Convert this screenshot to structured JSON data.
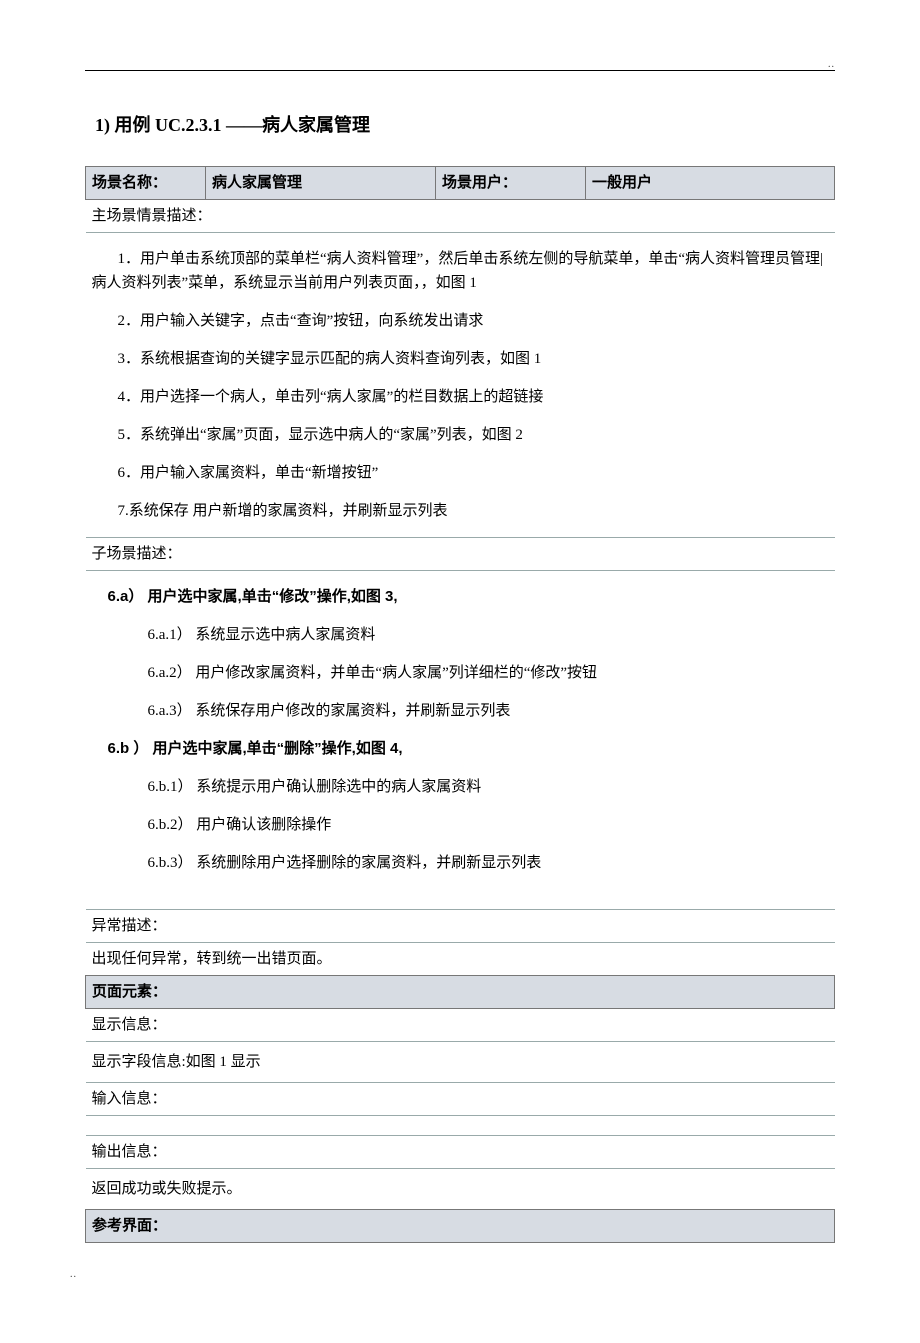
{
  "heading": "1)   用例 UC.2.3.1  ——病人家属管理",
  "header": {
    "scene_name_label": "场景名称：",
    "scene_name_value": "病人家属管理",
    "scene_user_label": "场景用户：",
    "scene_user_value": "一般用户"
  },
  "main_scene_label": "主场景情景描述：",
  "main_steps": [
    "1．用户单击系统顶部的菜单栏“病人资料管理”，然后单击系统左侧的导航菜单，单击“病人资料管理员管理|病人资料列表”菜单，系统显示当前用户列表页面，，如图 1",
    "2．用户输入关键字，点击“查询”按钮，向系统发出请求",
    "3．系统根据查询的关键字显示匹配的病人资料查询列表，如图 1",
    "4．用户选择一个病人，单击列“病人家属”的栏目数据上的超链接",
    "5．系统弹出“家属”页面，显示选中病人的“家属”列表，如图 2",
    "6．用户输入家属资料，单击“新增按钮”",
    "7.系统保存 用户新增的家属资料，并刷新显示列表"
  ],
  "sub_scene_label": "子场景描述：",
  "sub_a_heading": "6.a） 用户选中家属,单击“修改”操作,如图 3,",
  "sub_a_steps": [
    "6.a.1） 系统显示选中病人家属资料",
    "6.a.2） 用户修改家属资料，并单击“病人家属”列详细栏的“修改”按钮",
    "6.a.3） 系统保存用户修改的家属资料，并刷新显示列表"
  ],
  "sub_b_heading": "6.b ） 用户选中家属,单击“删除”操作,如图 4,",
  "sub_b_steps": [
    "6.b.1） 系统提示用户确认删除选中的病人家属资料",
    "6.b.2） 用户确认该删除操作",
    "6.b.3） 系统删除用户选择删除的家属资料，并刷新显示列表"
  ],
  "exception_label": "异常描述：",
  "exception_text": "出现任何异常，转到统一出错页面。",
  "page_elem_label": "页面元素：",
  "display_label": "显示信息：",
  "display_text": "显示字段信息:如图 1 显示",
  "input_label": "输入信息：",
  "output_label": "输出信息：",
  "output_text": "返回成功或失败提示。",
  "ref_ui_label": "参考界面："
}
